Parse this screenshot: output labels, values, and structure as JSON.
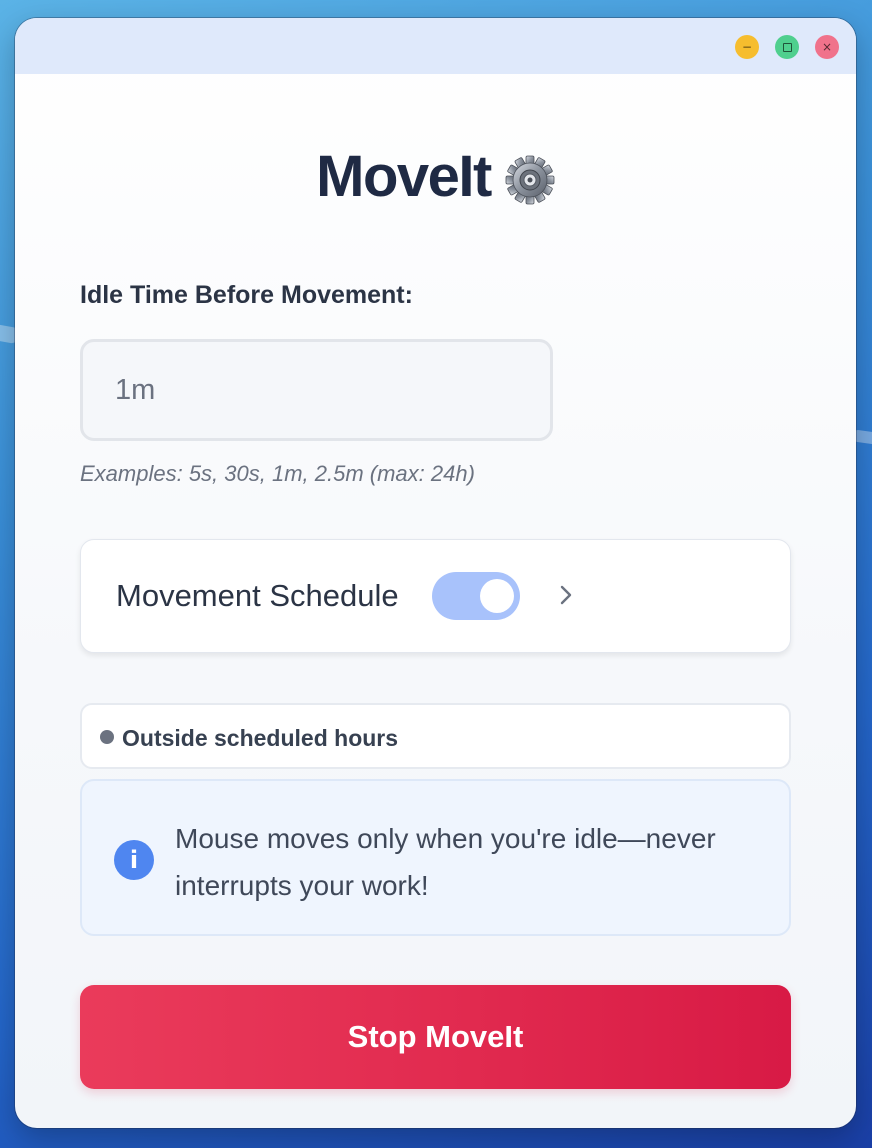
{
  "window": {
    "controls": {
      "minimize": "−",
      "maximize_icon": "square-icon",
      "close": "×"
    }
  },
  "app": {
    "title": "MoveIt",
    "title_icon": "gear-icon"
  },
  "idle": {
    "label": "Idle Time Before Movement:",
    "value": "1m",
    "examples": "Examples: 5s, 30s, 1m, 2.5m (max: 24h)"
  },
  "schedule": {
    "label": "Movement Schedule",
    "enabled": true,
    "chevron_icon": "chevron-right-icon"
  },
  "status": {
    "text": "Outside scheduled hours",
    "dot_color": "#6b7280"
  },
  "info": {
    "icon": "i",
    "text": "Mouse moves only when you're idle—never interrupts your work!"
  },
  "actions": {
    "stop_label": "Stop MoveIt"
  },
  "colors": {
    "accent_red": "#e12a4f",
    "toggle_on": "#a8c2fb",
    "info_blue": "#4f86f0",
    "title_text": "#1f2a44"
  }
}
